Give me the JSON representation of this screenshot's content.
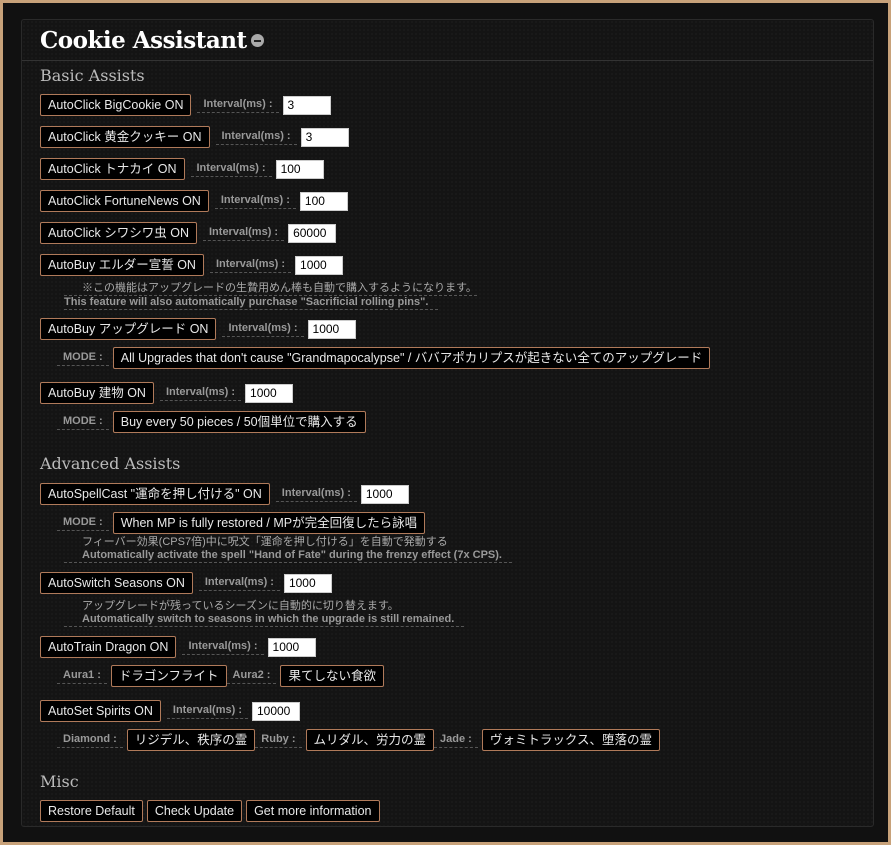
{
  "title": "Cookie Assistant",
  "sections": {
    "basic": "Basic Assists",
    "advanced": "Advanced Assists",
    "misc": "Misc"
  },
  "interval_label": "Interval(ms) :",
  "mode_label": "MODE :",
  "basic": {
    "bigcookie": {
      "btn": "AutoClick BigCookie ON",
      "val": "3"
    },
    "golden": {
      "btn": "AutoClick 黄金クッキー ON",
      "val": "3"
    },
    "reindeer": {
      "btn": "AutoClick トナカイ ON",
      "val": "100"
    },
    "fortune": {
      "btn": "AutoClick FortuneNews ON",
      "val": "100"
    },
    "wrinkler": {
      "btn": "AutoClick シワシワ虫 ON",
      "val": "60000"
    },
    "elder": {
      "btn": "AutoBuy エルダー宣誓 ON",
      "val": "1000",
      "note_ja": "※この機能はアップグレードの生贄用めん棒も自動で購入するようになります。",
      "note_en": "This feature will also automatically purchase \"Sacrificial rolling pins\"."
    },
    "upgrade": {
      "btn": "AutoBuy アップグレード ON",
      "val": "1000",
      "mode": "All Upgrades that don't cause \"Grandmapocalypse\" / ババアポカリプスが起きない全てのアップグレード"
    },
    "building": {
      "btn": "AutoBuy 建物 ON",
      "val": "1000",
      "mode": "Buy every 50 pieces / 50個単位で購入する"
    }
  },
  "advanced": {
    "spell": {
      "btn": "AutoSpellCast \"運命を押し付ける\" ON",
      "val": "1000",
      "mode": "When MP is fully restored / MPが完全回復したら詠唱",
      "note_ja": "フィーバー効果(CPS7倍)中に呪文「運命を押し付ける」を自動で発動する",
      "note_en": "Automatically activate the spell \"Hand of Fate\" during the frenzy effect (7x CPS)."
    },
    "seasons": {
      "btn": "AutoSwitch Seasons ON",
      "val": "1000",
      "note_ja": "アップグレードが残っているシーズンに自動的に切り替えます。",
      "note_en": "Automatically switch to seasons in which the upgrade is still remained."
    },
    "dragon": {
      "btn": "AutoTrain Dragon ON",
      "val": "1000",
      "aura1_label": "Aura1 :",
      "aura1": "ドラゴンフライト",
      "aura2_label": "Aura2 :",
      "aura2": "果てしない食欲"
    },
    "spirits": {
      "btn": "AutoSet Spirits ON",
      "val": "10000",
      "diamond_label": "Diamond :",
      "diamond": "リジデル、秩序の霊",
      "ruby_label": "Ruby :",
      "ruby": "ムリダル、労力の霊",
      "jade_label": "Jade :",
      "jade": "ヴォミトラックス、堕落の霊"
    }
  },
  "misc": {
    "restore": "Restore Default",
    "check": "Check Update",
    "info": "Get more information"
  }
}
